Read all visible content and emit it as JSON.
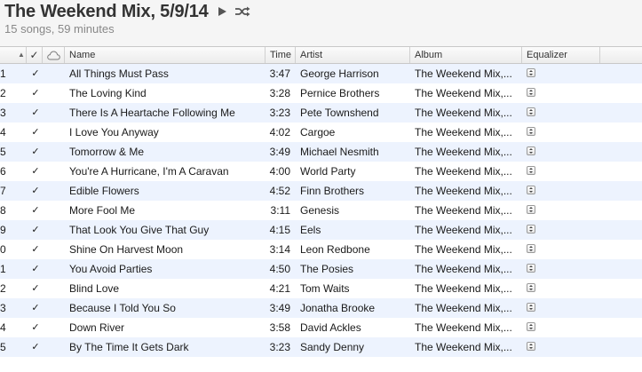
{
  "header": {
    "title": "The Weekend Mix, 5/9/14",
    "subtitle": "15 songs, 59 minutes",
    "play_icon": "play-icon",
    "shuffle_icon": "shuffle-icon"
  },
  "columns": {
    "sort_indicator": "▲",
    "check": "✓",
    "cloud_icon": "cloud-icon",
    "name": "Name",
    "time": "Time",
    "artist": "Artist",
    "album": "Album",
    "equalizer": "Equalizer"
  },
  "tracks": [
    {
      "num": "1",
      "check": "✓",
      "name": "All Things Must Pass",
      "time": "3:47",
      "artist": "George Harrison",
      "album": "The Weekend Mix,..."
    },
    {
      "num": "2",
      "check": "✓",
      "name": "The Loving Kind",
      "time": "3:28",
      "artist": "Pernice Brothers",
      "album": "The Weekend Mix,..."
    },
    {
      "num": "3",
      "check": "✓",
      "name": "There Is A Heartache Following Me",
      "time": "3:23",
      "artist": "Pete Townshend",
      "album": "The Weekend Mix,..."
    },
    {
      "num": "4",
      "check": "✓",
      "name": "I Love You Anyway",
      "time": "4:02",
      "artist": "Cargoe",
      "album": "The Weekend Mix,..."
    },
    {
      "num": "5",
      "check": "✓",
      "name": "Tomorrow & Me",
      "time": "3:49",
      "artist": "Michael Nesmith",
      "album": "The Weekend Mix,..."
    },
    {
      "num": "6",
      "check": "✓",
      "name": "You're A Hurricane, I'm A Caravan",
      "time": "4:00",
      "artist": "World Party",
      "album": "The Weekend Mix,..."
    },
    {
      "num": "7",
      "check": "✓",
      "name": "Edible Flowers",
      "time": "4:52",
      "artist": "Finn Brothers",
      "album": "The Weekend Mix,..."
    },
    {
      "num": "8",
      "check": "✓",
      "name": "More Fool Me",
      "time": "3:11",
      "artist": "Genesis",
      "album": "The Weekend Mix,..."
    },
    {
      "num": "9",
      "check": "✓",
      "name": "That Look You Give That Guy",
      "time": "4:15",
      "artist": "Eels",
      "album": "The Weekend Mix,..."
    },
    {
      "num": "0",
      "check": "✓",
      "name": "Shine On Harvest Moon",
      "time": "3:14",
      "artist": "Leon Redbone",
      "album": "The Weekend Mix,..."
    },
    {
      "num": "1",
      "check": "✓",
      "name": "You Avoid Parties",
      "time": "4:50",
      "artist": "The Posies",
      "album": "The Weekend Mix,..."
    },
    {
      "num": "2",
      "check": "✓",
      "name": "Blind Love",
      "time": "4:21",
      "artist": "Tom Waits",
      "album": "The Weekend Mix,..."
    },
    {
      "num": "3",
      "check": "✓",
      "name": "Because I Told You So",
      "time": "3:49",
      "artist": "Jonatha Brooke",
      "album": "The Weekend Mix,..."
    },
    {
      "num": "4",
      "check": "✓",
      "name": "Down River",
      "time": "3:58",
      "artist": "David Ackles",
      "album": "The Weekend Mix,..."
    },
    {
      "num": "5",
      "check": "✓",
      "name": "By The Time It Gets Dark",
      "time": "3:23",
      "artist": "Sandy Denny",
      "album": "The Weekend Mix,..."
    }
  ]
}
